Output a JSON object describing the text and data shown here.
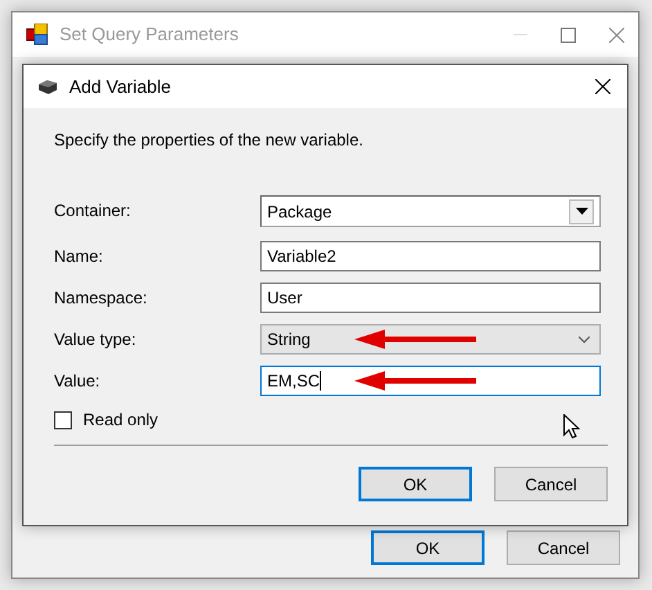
{
  "background_window": {
    "title": "Set Query Parameters",
    "buttons": [
      {
        "label": "OK",
        "default": true
      },
      {
        "label": "Cancel",
        "default": false
      }
    ]
  },
  "dialog": {
    "title": "Add Variable",
    "instruction": "Specify the properties of the new variable.",
    "fields": [
      {
        "kind": "dropdown",
        "label": "Container:",
        "value": "Package",
        "arrow": false
      },
      {
        "kind": "text",
        "label": "Name:",
        "value": "Variable2",
        "focused": false,
        "arrow": false
      },
      {
        "kind": "text",
        "label": "Namespace:",
        "value": "User",
        "focused": false,
        "arrow": false
      },
      {
        "kind": "combo",
        "label": "Value type:",
        "value": "String",
        "arrow": true
      },
      {
        "kind": "text",
        "label": "Value:",
        "value": "EM,SC",
        "focused": true,
        "arrow": true
      }
    ],
    "read_only": {
      "label": "Read only",
      "checked": false
    },
    "buttons": [
      {
        "label": "OK",
        "default": true
      },
      {
        "label": "Cancel",
        "default": false
      }
    ]
  }
}
